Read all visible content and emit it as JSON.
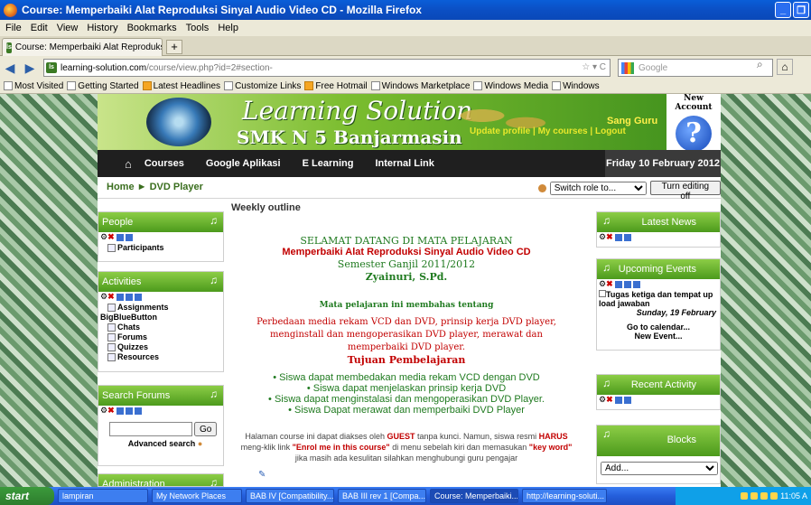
{
  "window": {
    "title": "Course: Memperbaiki Alat Reproduksi Sinyal Audio Video CD - Mozilla Firefox"
  },
  "menu": [
    "File",
    "Edit",
    "View",
    "History",
    "Bookmarks",
    "Tools",
    "Help"
  ],
  "tab": {
    "label": "Course: Memperbaiki Alat Reproduksi Sinyal ...",
    "new_tab": "+"
  },
  "address": {
    "host": "learning-solution.com",
    "path": "/course/view.php?id=2#section-"
  },
  "search": {
    "placeholder": "Google"
  },
  "bookmarks": [
    "Most Visited",
    "Getting Started",
    "Latest Headlines",
    "Customize Links",
    "Free Hotmail",
    "Windows Marketplace",
    "Windows Media",
    "Windows"
  ],
  "site": {
    "logo_line1": "Learning Solution",
    "logo_line2": "SMK N 5 Banjarmasin",
    "user_links": {
      "update": "Update profile",
      "sep1": " | ",
      "courses": "My courses",
      "sep2": " | ",
      "logout": "Logout"
    },
    "user_name": "Sang Guru",
    "new_account": "New Account",
    "nav": [
      "Courses",
      "Google Aplikasi",
      "E Learning",
      "Internal Link"
    ],
    "date": "Friday 10 February 2012",
    "breadcrumb": {
      "home": "Home",
      "sep": "►",
      "current": "DVD Player"
    },
    "role_select": "Switch role to...",
    "edit_button": "Turn editing off"
  },
  "left_blocks": {
    "people": {
      "title": "People",
      "items": [
        "Participants"
      ]
    },
    "activities": {
      "title": "Activities",
      "items": [
        "Assignments",
        "BigBlueButton",
        "Chats",
        "Forums",
        "Quizzes",
        "Resources"
      ]
    },
    "search_forums": {
      "title": "Search Forums",
      "go": "Go",
      "advanced": "Advanced search"
    },
    "administration": {
      "title": "Administration"
    }
  },
  "content": {
    "heading": "Weekly outline",
    "welcome": "SELAMAT DATANG DI MATA PELAJARAN",
    "course_title": "Memperbaiki Alat Reproduksi Sinyal Audio Video CD",
    "semester": "Semester Ganjil 2011/2012",
    "teacher": "Zyainuri, S.Pd.",
    "topics_heading": "Mata pelajaran ini membahas tentang",
    "topics_text": "Perbedaan media rekam VCD dan DVD, prinsip kerja DVD player, menginstall dan mengoperasikan DVD player, merawat dan memperbaiki DVD player.",
    "goals_heading": "Tujuan Pembelajaran",
    "goals": [
      "Siswa dapat membedakan media rekam VCD dengan DVD",
      "Siswa dapat menjelaskan prinsip kerja DVD",
      "Siswa dapat menginstalasi dan mengoperasikan DVD Player.",
      "Siswa Dapat merawat dan memperbaiki DVD Player"
    ],
    "note_a": "Halaman course ini dapat diakses oleh ",
    "note_guest": "GUEST",
    "note_b": " tanpa kunci. Namun, siswa resmi ",
    "note_harus": "HARUS",
    "note_c": " meng-klik link ",
    "note_enrol": "\"Enrol me in this course\"",
    "note_d": " di menu sebelah kiri dan memasukan ",
    "note_key": "\"key word\"",
    "note_e": " jika masih ada kesulitan silahkan menghubungi guru pengajar"
  },
  "right_blocks": {
    "latest_news": {
      "title": "Latest News"
    },
    "upcoming": {
      "title": "Upcoming Events",
      "event": "Tugas ketiga dan tempat up load jawaban",
      "event_date": "Sunday, 19 February",
      "calendar": "Go to calendar...",
      "new_event": "New Event..."
    },
    "recent": {
      "title": "Recent Activity"
    },
    "blocks": {
      "title": "Blocks",
      "select": "Add..."
    }
  },
  "taskbar": {
    "start": "start",
    "items": [
      "lampiran",
      "My Network Places",
      "BAB IV [Compatibility...",
      "BAB III rev 1 [Compa...",
      "Course: Memperbaiki...",
      "http://learning-soluti..."
    ],
    "clock": "11:05 A"
  }
}
